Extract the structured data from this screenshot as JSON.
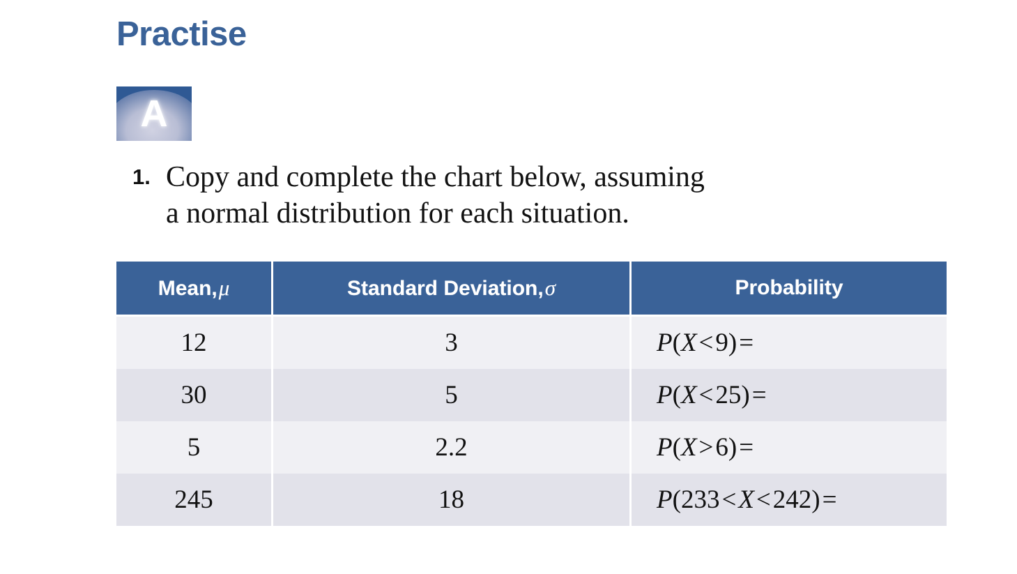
{
  "heading": {
    "title": "Practise"
  },
  "badge": {
    "letter": "A",
    "background_color": "#2F5994",
    "letter_color": "#FFFFFF"
  },
  "question": {
    "number": "1.",
    "line1": "Copy and complete the chart below, assuming",
    "line2": "a normal distribution for each situation."
  },
  "table": {
    "header_background": "#3A6298",
    "header_text_color": "#FFFFFF",
    "row_color_odd": "#F0F0F4",
    "row_color_even": "#E2E2EA",
    "columns": [
      {
        "label": "Mean,",
        "symbol": "μ"
      },
      {
        "label": "Standard Deviation,",
        "symbol": "σ"
      },
      {
        "label": "Probability",
        "symbol": ""
      }
    ],
    "rows": [
      {
        "mean": "12",
        "sd": "3",
        "prob": {
          "p": "P",
          "open": "(",
          "var_left": "X",
          "op1": "<",
          "val1": "9",
          "close": ")",
          "equals": "="
        }
      },
      {
        "mean": "30",
        "sd": "5",
        "prob": {
          "p": "P",
          "open": "(",
          "var_left": "X",
          "op1": "<",
          "val1": "25",
          "close": ")",
          "equals": "="
        }
      },
      {
        "mean": "5",
        "sd": "2.2",
        "prob": {
          "p": "P",
          "open": "(",
          "var_left": "X",
          "op1": ">",
          "val1": "6",
          "close": ")",
          "equals": "="
        }
      },
      {
        "mean": "245",
        "sd": "18",
        "prob": {
          "p": "P",
          "open": "(",
          "val0": "233",
          "op0": "<",
          "var_left": "X",
          "op1": "<",
          "val1": "242",
          "close": ")",
          "equals": "="
        }
      }
    ]
  }
}
